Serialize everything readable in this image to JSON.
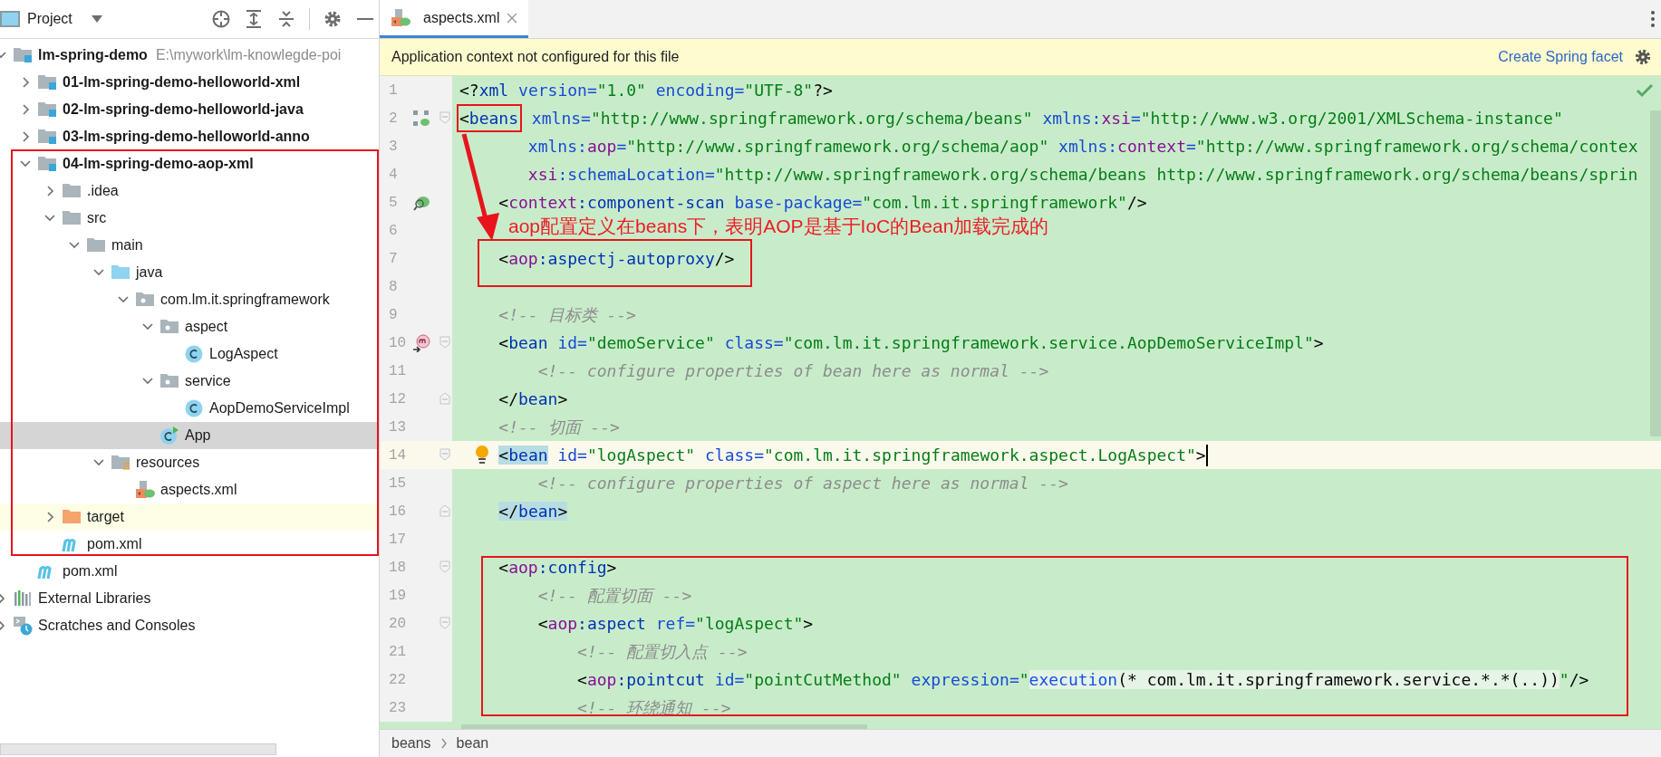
{
  "project_panel": {
    "title": "Project",
    "items": [
      {
        "label": "lm-spring-demo",
        "path": "E:\\mywork\\lm-knowlegde-poi",
        "kind": "module",
        "expanded": true,
        "selected": false,
        "children": [
          {
            "label": "01-lm-spring-demo-helloworld-xml",
            "kind": "module",
            "expanded": false,
            "selected": false
          },
          {
            "label": "02-lm-spring-demo-helloworld-java",
            "kind": "module",
            "expanded": false,
            "selected": false
          },
          {
            "label": "03-lm-spring-demo-helloworld-anno",
            "kind": "module",
            "expanded": false,
            "selected": false
          },
          {
            "label": "04-lm-spring-demo-aop-xml",
            "kind": "module",
            "expanded": true,
            "selected": false,
            "children": [
              {
                "label": ".idea",
                "kind": "folder",
                "expanded": false,
                "selected": false
              },
              {
                "label": "src",
                "kind": "folder",
                "expanded": true,
                "selected": false,
                "children": [
                  {
                    "label": "main",
                    "kind": "folder",
                    "expanded": true,
                    "selected": false,
                    "children": [
                      {
                        "label": "java",
                        "kind": "source",
                        "expanded": true,
                        "selected": false,
                        "children": [
                          {
                            "label": "com.lm.it.springframework",
                            "kind": "package",
                            "expanded": true,
                            "selected": false,
                            "children": [
                              {
                                "label": "aspect",
                                "kind": "package",
                                "expanded": true,
                                "selected": false,
                                "children": [
                                  {
                                    "label": "LogAspect",
                                    "kind": "class",
                                    "selected": false
                                  }
                                ]
                              },
                              {
                                "label": "service",
                                "kind": "package",
                                "expanded": true,
                                "selected": false,
                                "children": [
                                  {
                                    "label": "AopDemoServiceImpl",
                                    "kind": "class",
                                    "selected": false
                                  }
                                ]
                              },
                              {
                                "label": "App",
                                "kind": "app",
                                "selected": true
                              }
                            ]
                          }
                        ]
                      },
                      {
                        "label": "resources",
                        "kind": "resources",
                        "expanded": true,
                        "selected": false,
                        "children": [
                          {
                            "label": "aspects.xml",
                            "kind": "springxml",
                            "selected": false
                          }
                        ]
                      }
                    ]
                  }
                ]
              },
              {
                "label": "target",
                "kind": "excluded",
                "expanded": false,
                "selected": false
              },
              {
                "label": "pom.xml",
                "kind": "maven",
                "selected": false
              }
            ]
          },
          {
            "label": "pom.xml",
            "kind": "maven",
            "selected": false
          }
        ]
      },
      {
        "label": "External Libraries",
        "kind": "libraries",
        "expanded": false,
        "selected": false
      },
      {
        "label": "Scratches and Consoles",
        "kind": "scratches",
        "expanded": false,
        "selected": false
      }
    ]
  },
  "editor": {
    "tabs": [
      {
        "label": "aspects.xml",
        "selected": true
      }
    ],
    "banner": {
      "message": "Application context not configured for this file",
      "link": "Create Spring facet"
    },
    "annotation": {
      "text": "aop配置定义在beans下，表明AOP是基于IoC的Bean加载完成的"
    },
    "lines": [
      {
        "number": "1",
        "current": false,
        "segments": [
          {
            "text": "<?",
            "kind": "p"
          },
          {
            "text": "xml",
            "kind": "t"
          },
          {
            "text": " version=",
            "kind": "a"
          },
          {
            "text": "\"1.0\"",
            "kind": "v"
          },
          {
            "text": " encoding=",
            "kind": "a"
          },
          {
            "text": "\"UTF-8\"",
            "kind": "v"
          },
          {
            "text": "?>",
            "kind": "p"
          }
        ]
      },
      {
        "number": "2",
        "current": false,
        "gutter": {
          "kind": "beans"
        },
        "fold": {
          "kind": "open"
        },
        "segments": [
          {
            "text": "<",
            "kind": "p",
            "boxed": true
          },
          {
            "text": "beans",
            "kind": "t",
            "boxed": true
          },
          {
            "text": " xmlns=",
            "kind": "a"
          },
          {
            "text": "\"http://www.springframework.org/schema/beans\"",
            "kind": "v"
          },
          {
            "text": " xmlns:",
            "kind": "a"
          },
          {
            "text": "xsi",
            "kind": "n"
          },
          {
            "text": "=",
            "kind": "a"
          },
          {
            "text": "\"http://www.w3.org/2001/XMLSchema-instance\"",
            "kind": "v"
          }
        ]
      },
      {
        "number": "3",
        "current": false,
        "segments": [
          {
            "text": "       xmlns:",
            "kind": "a"
          },
          {
            "text": "aop",
            "kind": "n"
          },
          {
            "text": "=",
            "kind": "a"
          },
          {
            "text": "\"http://www.springframework.org/schema/aop\"",
            "kind": "v"
          },
          {
            "text": " xmlns:",
            "kind": "a"
          },
          {
            "text": "context",
            "kind": "n"
          },
          {
            "text": "=",
            "kind": "a"
          },
          {
            "text": "\"http://www.springframework.org/schema/contex",
            "kind": "v"
          }
        ]
      },
      {
        "number": "4",
        "current": false,
        "segments": [
          {
            "text": "       xsi",
            "kind": "n"
          },
          {
            "text": ":schemaLocation=",
            "kind": "a"
          },
          {
            "text": "\"http://www.springframework.org/schema/beans http://www.springframework.org/schema/beans/sprin",
            "kind": "v"
          }
        ]
      },
      {
        "number": "5",
        "current": false,
        "gutter": {
          "kind": "scan"
        },
        "segments": [
          {
            "text": "    <",
            "kind": "p"
          },
          {
            "text": "context",
            "kind": "n"
          },
          {
            "text": ":component-scan",
            "kind": "t"
          },
          {
            "text": " base-package=",
            "kind": "a"
          },
          {
            "text": "\"com.lm.it.springframework\"",
            "kind": "v"
          },
          {
            "text": "/>",
            "kind": "p"
          }
        ]
      },
      {
        "number": "6",
        "current": false
      },
      {
        "number": "7",
        "current": false,
        "segments": [
          {
            "text": "    <",
            "kind": "p"
          },
          {
            "text": "aop",
            "kind": "n"
          },
          {
            "text": ":aspectj-autoproxy",
            "kind": "t"
          },
          {
            "text": "/>",
            "kind": "p"
          }
        ]
      },
      {
        "number": "8",
        "current": false
      },
      {
        "number": "9",
        "current": false,
        "segments": [
          {
            "text": "    <!-- 目标类 -->",
            "kind": "c"
          }
        ]
      },
      {
        "number": "10",
        "current": false,
        "gutter": {
          "kind": "method"
        },
        "fold": {
          "kind": "open"
        },
        "segments": [
          {
            "text": "    <",
            "kind": "p"
          },
          {
            "text": "bean",
            "kind": "t"
          },
          {
            "text": " id=",
            "kind": "a"
          },
          {
            "text": "\"demoService\"",
            "kind": "v"
          },
          {
            "text": " class=",
            "kind": "a"
          },
          {
            "text": "\"com.lm.it.springframework.service.AopDemoServiceImpl\"",
            "kind": "v"
          },
          {
            "text": ">",
            "kind": "p"
          }
        ]
      },
      {
        "number": "11",
        "current": false,
        "segments": [
          {
            "text": "        <!-- configure properties of bean here as normal -->",
            "kind": "c"
          }
        ]
      },
      {
        "number": "12",
        "current": false,
        "fold": {
          "kind": "end"
        },
        "segments": [
          {
            "text": "    </",
            "kind": "p"
          },
          {
            "text": "bean",
            "kind": "t"
          },
          {
            "text": ">",
            "kind": "p"
          }
        ]
      },
      {
        "number": "13",
        "current": false,
        "segments": [
          {
            "text": "    <!-- 切面 -->",
            "kind": "c"
          }
        ]
      },
      {
        "number": "14",
        "current": true,
        "bulb": true,
        "cursor": true,
        "fold": {
          "kind": "open"
        },
        "segments": [
          {
            "text": "    <",
            "kind": "p",
            "matched": true
          },
          {
            "text": "bean",
            "kind": "t",
            "matched": true
          },
          {
            "text": " id=",
            "kind": "a"
          },
          {
            "text": "\"logAspect\"",
            "kind": "v"
          },
          {
            "text": " class=",
            "kind": "a"
          },
          {
            "text": "\"com.lm.it.springframework.aspect.LogAspect\"",
            "kind": "v"
          },
          {
            "text": ">",
            "kind": "p"
          }
        ]
      },
      {
        "number": "15",
        "current": false,
        "segments": [
          {
            "text": "        <!-- configure properties of aspect here as normal -->",
            "kind": "c"
          }
        ]
      },
      {
        "number": "16",
        "current": false,
        "fold": {
          "kind": "end"
        },
        "segments": [
          {
            "text": "    </",
            "kind": "p",
            "matched": true
          },
          {
            "text": "bean",
            "kind": "t",
            "matched": true
          },
          {
            "text": ">",
            "kind": "p",
            "matched": true
          }
        ]
      },
      {
        "number": "17",
        "current": false
      },
      {
        "number": "18",
        "current": false,
        "fold": {
          "kind": "open"
        },
        "segments": [
          {
            "text": "    <",
            "kind": "p"
          },
          {
            "text": "aop",
            "kind": "n"
          },
          {
            "text": ":config",
            "kind": "t"
          },
          {
            "text": ">",
            "kind": "p"
          }
        ]
      },
      {
        "number": "19",
        "current": false,
        "segments": [
          {
            "text": "        <!-- 配置切面 -->",
            "kind": "c"
          }
        ]
      },
      {
        "number": "20",
        "current": false,
        "fold": {
          "kind": "open"
        },
        "segments": [
          {
            "text": "        <",
            "kind": "p"
          },
          {
            "text": "aop",
            "kind": "n"
          },
          {
            "text": ":aspect",
            "kind": "t"
          },
          {
            "text": " ref=",
            "kind": "a"
          },
          {
            "text": "\"logAspect\"",
            "kind": "v"
          },
          {
            "text": ">",
            "kind": "p"
          }
        ]
      },
      {
        "number": "21",
        "current": false,
        "segments": [
          {
            "text": "            <!-- 配置切入点 -->",
            "kind": "c"
          }
        ]
      },
      {
        "number": "22",
        "current": false,
        "segments": [
          {
            "text": "            <",
            "kind": "p"
          },
          {
            "text": "aop",
            "kind": "n"
          },
          {
            "text": ":pointcut",
            "kind": "t"
          },
          {
            "text": " id=",
            "kind": "a"
          },
          {
            "text": "\"pointCutMethod\"",
            "kind": "v"
          },
          {
            "text": " expression=",
            "kind": "a"
          },
          {
            "text": "\"",
            "kind": "v"
          },
          {
            "text": "execution",
            "kind": "f",
            "injected": true
          },
          {
            "text": "(* com.lm.it.springframework.service.*.*(..))",
            "kind": "p",
            "injected": true
          },
          {
            "text": "\"",
            "kind": "v"
          },
          {
            "text": "/>",
            "kind": "p"
          }
        ]
      },
      {
        "number": "23",
        "current": false,
        "segments": [
          {
            "text": "            <!-- 环绕通知 -->",
            "kind": "c"
          }
        ]
      }
    ],
    "breadcrumbs": [
      "beans",
      "bean"
    ]
  }
}
